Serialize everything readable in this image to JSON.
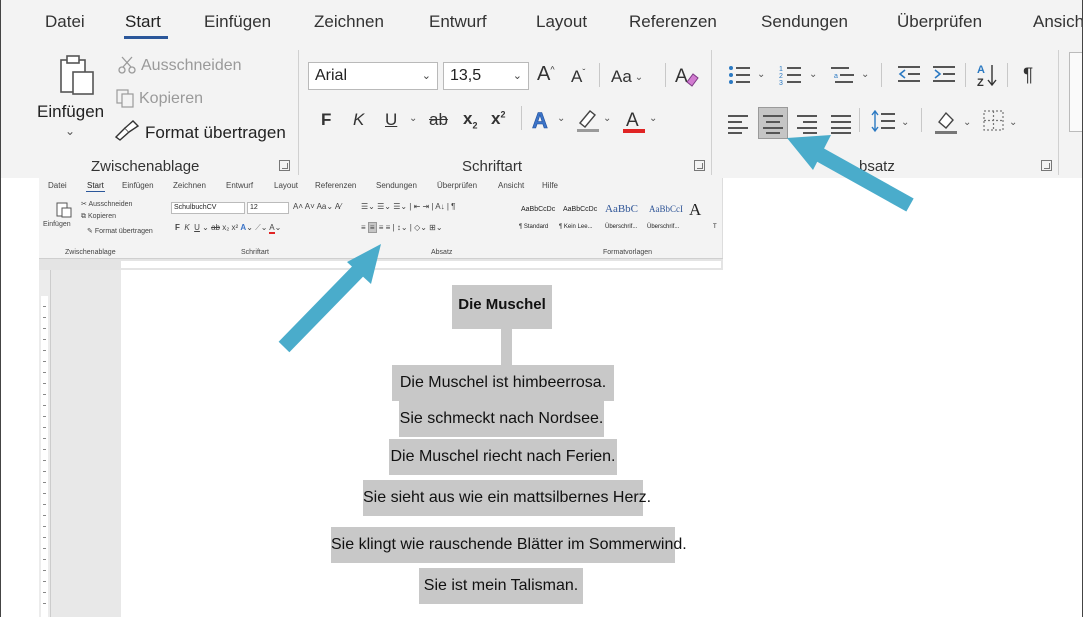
{
  "ribbon": {
    "tabs": [
      "Datei",
      "Start",
      "Einfügen",
      "Zeichnen",
      "Entwurf",
      "Layout",
      "Referenzen",
      "Sendungen",
      "Überprüfen",
      "Ansich"
    ],
    "clipboard": {
      "paste": "Einfügen",
      "cut": "Ausschneiden",
      "copy": "Kopieren",
      "format_painter": "Format übertragen",
      "group": "Zwischenablage"
    },
    "font": {
      "name": "Arial",
      "size": "13,5",
      "case": "Aa",
      "bold": "F",
      "italic": "K",
      "underline": "U",
      "strike": "ab",
      "subscript": "x",
      "superscript": "x",
      "group": "Schriftart"
    },
    "paragraph": {
      "group": "Absatz",
      "group_visible": "bsatz",
      "pilcrow": "¶"
    }
  },
  "small_ribbon": {
    "tabs": [
      "Datei",
      "Start",
      "Einfügen",
      "Zeichnen",
      "Entwurf",
      "Layout",
      "Referenzen",
      "Sendungen",
      "Überprüfen",
      "Ansicht",
      "Hilfe"
    ],
    "cut": "Ausschneiden",
    "copy": "Kopieren",
    "paste": "Einfügen",
    "format_painter": "Format übertragen",
    "font_name": "SchulbuchCV",
    "font_size": "12",
    "groups": [
      "Zwischenablage",
      "Schriftart",
      "Absatz",
      "Formatvorlagen"
    ],
    "styles": [
      {
        "preview": "AaBbCcDc",
        "name": "¶ Standard"
      },
      {
        "preview": "AaBbCcDc",
        "name": "¶ Kein Lee..."
      },
      {
        "preview": "AaBbC",
        "name": "Überschrif..."
      },
      {
        "preview": "AaBbCcI",
        "name": "Überschrif..."
      },
      {
        "preview": "A",
        "name": "T"
      }
    ]
  },
  "document": {
    "title": "Die Muschel",
    "lines": [
      "Die Muschel ist himbeerrosa.",
      "Sie schmeckt nach Nordsee.",
      "Die Muschel riecht nach Ferien.",
      "Sie sieht aus wie ein mattsilbernes Herz.",
      "Sie klingt wie rauschende Blätter im Sommerwind.",
      "Sie ist mein Talisman."
    ]
  },
  "colors": {
    "arrow": "#4aaccb",
    "tree_box": "#c8c8c8",
    "ribbon_bg": "#f3f3f3",
    "accent": "#2b579a"
  }
}
